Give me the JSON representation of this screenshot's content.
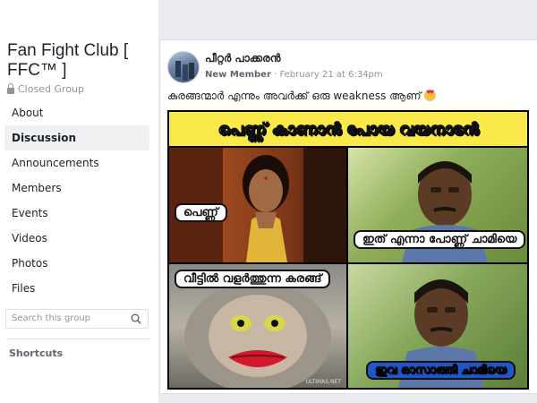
{
  "group": {
    "name": "Fan Fight Club [ FFC™ ]",
    "privacy": "Closed Group"
  },
  "nav": {
    "items": [
      {
        "label": "About",
        "active": false
      },
      {
        "label": "Discussion",
        "active": true
      },
      {
        "label": "Announcements",
        "active": false
      },
      {
        "label": "Members",
        "active": false
      },
      {
        "label": "Events",
        "active": false
      },
      {
        "label": "Videos",
        "active": false
      },
      {
        "label": "Photos",
        "active": false
      },
      {
        "label": "Files",
        "active": false
      }
    ]
  },
  "search": {
    "placeholder": "Search this group"
  },
  "shortcuts": {
    "label": "Shortcuts"
  },
  "post": {
    "author": "പീറ്റർ പാക്കരൻ",
    "role": "New Member",
    "separator": "·",
    "timestamp": "February 21 at 6:34pm",
    "caption": "കുരങ്ങന്മാർ എന്നും അവർക്ക് ഒരു weakness ആണ്",
    "caption_emoji": "heart-eyes-emoji"
  },
  "meme": {
    "title": "പെണ്ണ് കാണാൻ പോയ വയനാടൻ",
    "panel1_label": "പെണ്ണ്",
    "panel2_label": "ഇത് എന്നാ പോണ്ണ് ചാമിയെ",
    "panel3_label": "വീട്ടിൽ വളർത്തുന്ന കരങ്ങ്",
    "panel4_label": "ഇവ രാസാത്തി ചാമിയെ",
    "watermark": "ULTIMAS.NET"
  },
  "colors": {
    "banner": "#fbe94a",
    "page_bg": "#e9ebee",
    "text": "#1d2129",
    "muted": "#90949c"
  }
}
